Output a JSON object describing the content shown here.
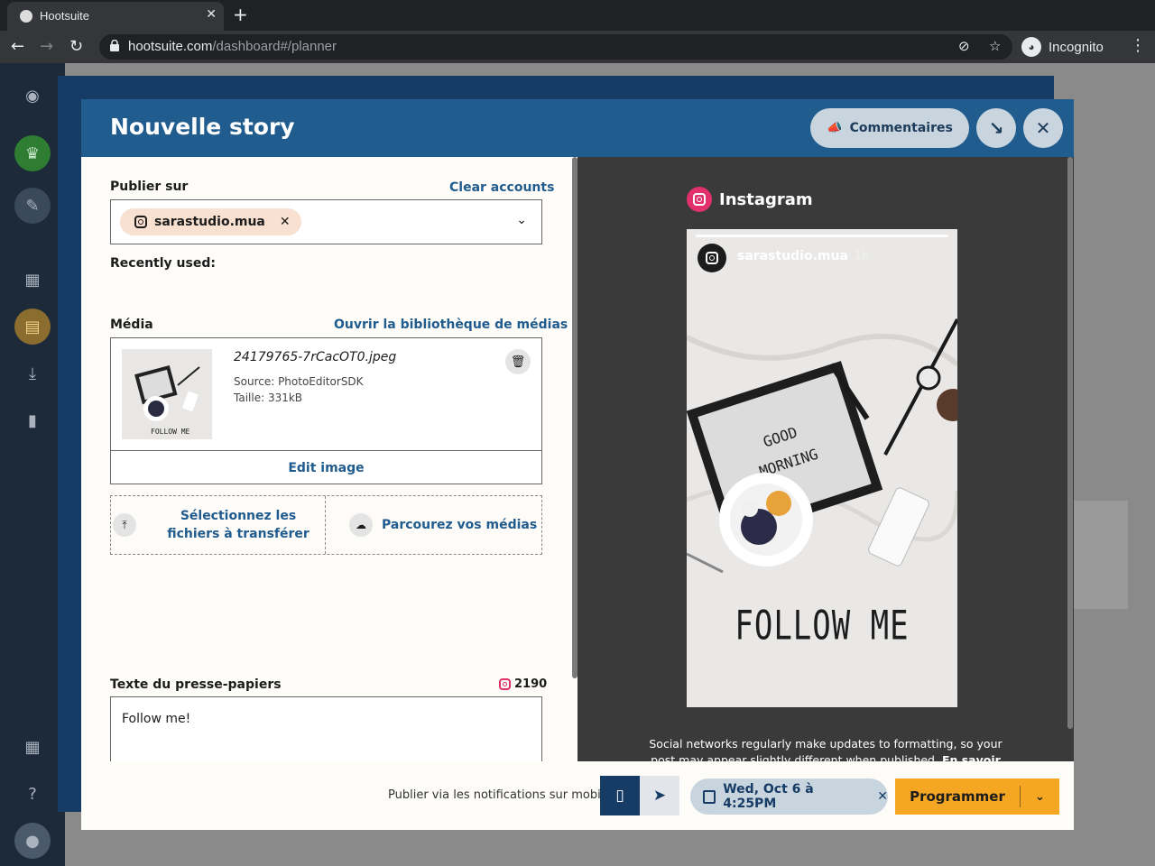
{
  "browser": {
    "tab_title": "Hootsuite",
    "url_main": "hootsuite.com",
    "url_path": "/dashboard#/planner",
    "incognito_label": "Incognito"
  },
  "modal": {
    "title": "Nouvelle story",
    "comments_label": "Commentaires"
  },
  "publish": {
    "label": "Publier sur",
    "clear_label": "Clear accounts",
    "account": "sarastudio.mua",
    "recent_label": "Recently used:"
  },
  "media": {
    "label": "Média",
    "library_link": "Ouvrir la bibliothèque de médias",
    "file_name": "24179765-7rCacOT0.jpeg",
    "source": "Source: PhotoEditorSDK",
    "size": "Taille: 331kB",
    "edit_label": "Edit image",
    "upload_label": "Sélectionnez les fichiers à transférer",
    "browse_label": "Parcourez vos médias",
    "thumb_caption": "FOLLOW ME"
  },
  "clipboard": {
    "label": "Texte du presse-papiers",
    "count": "2190",
    "text": "Follow me!"
  },
  "preview": {
    "network": "Instagram",
    "user": "sarastudio.mua",
    "time": "1h",
    "caption": "FOLLOW ME",
    "disclaimer": "Social networks regularly make updates to formatting, so your post may appear slightly different when published.",
    "learn_more": "En savoir plus"
  },
  "footer": {
    "notice": "Publier via les notifications sur mobile",
    "date": "Wed, Oct 6 à 4:25PM",
    "schedule_label": "Programmer"
  }
}
